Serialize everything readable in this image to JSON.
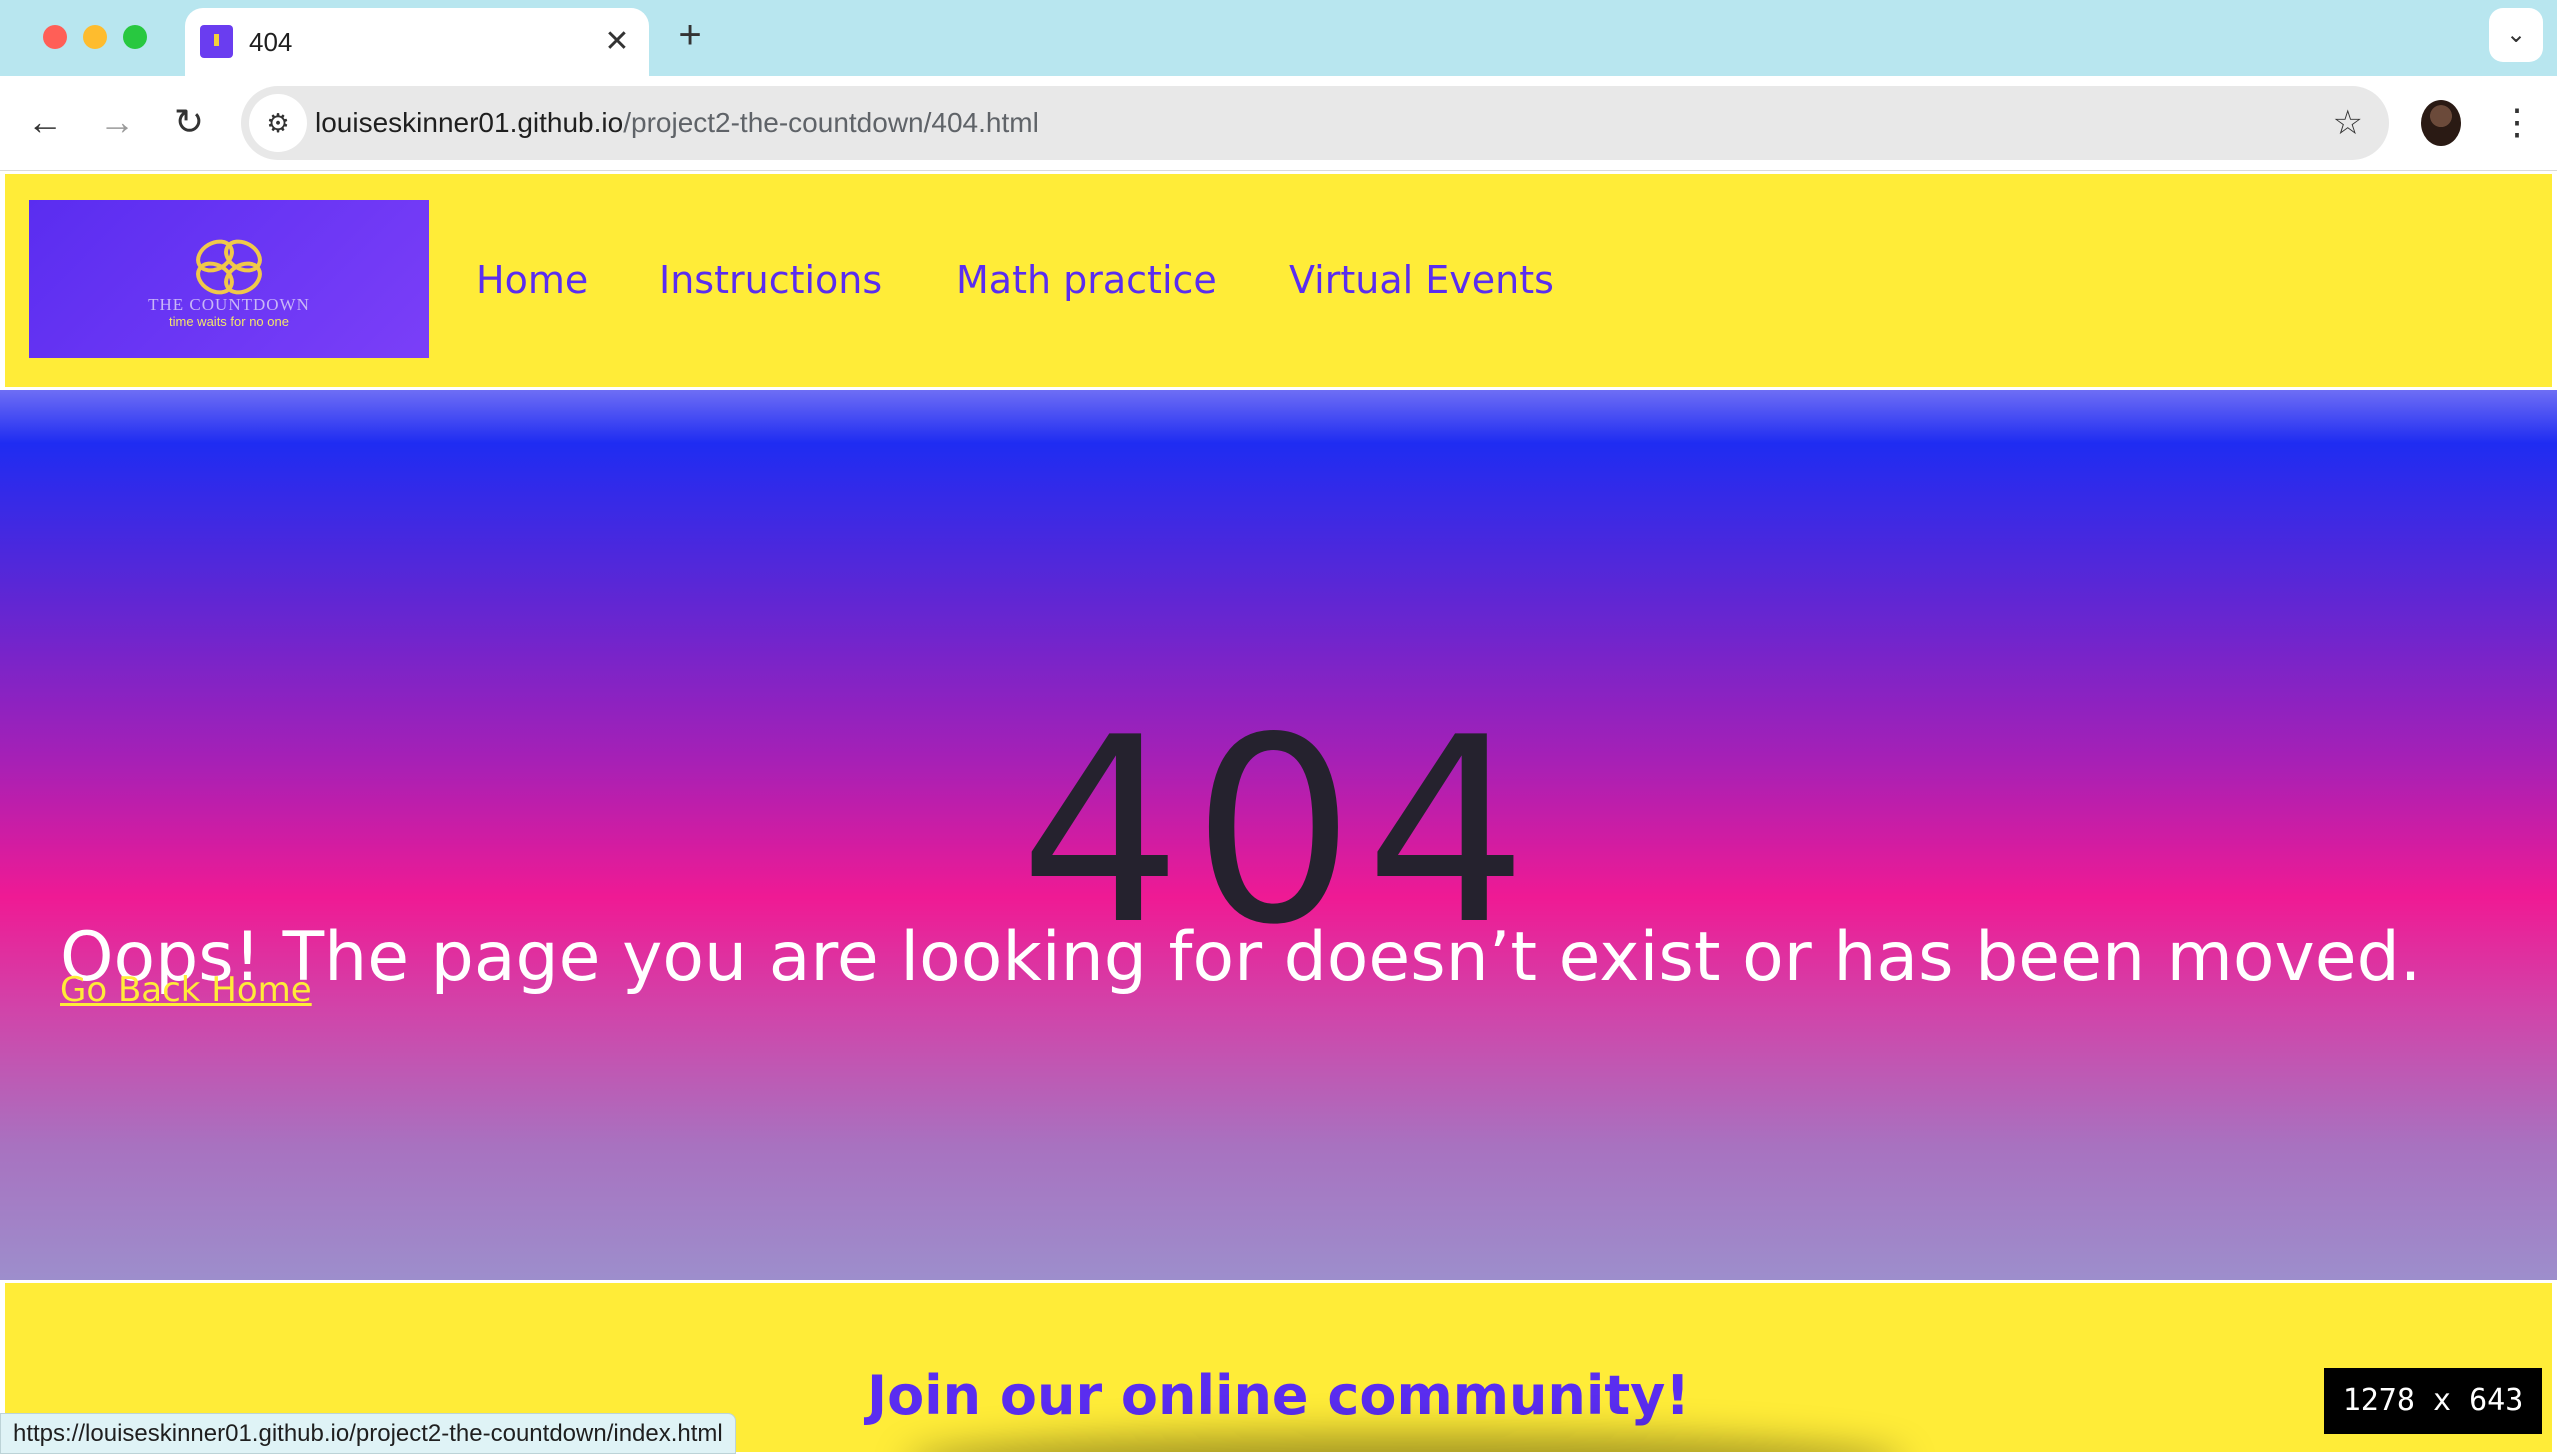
{
  "browser": {
    "tab": {
      "title": "404",
      "close_glyph": "✕"
    },
    "new_tab_glyph": "+",
    "tab_search_glyph": "⌄",
    "nav": {
      "back_glyph": "←",
      "forward_glyph": "→",
      "reload_glyph": "↻"
    },
    "url": {
      "domain": "louiseskinner01.github.io",
      "path": "/project2-the-countdown/404.html"
    },
    "site_info_glyph": "⚙",
    "bookmark_glyph": "☆",
    "menu_glyph": "⋮",
    "status_url": "https://louiseskinner01.github.io/project2-the-countdown/index.html",
    "viewport_size": "1278 x 643"
  },
  "site": {
    "logo": {
      "name": "THE COUNTDOWN",
      "tagline": "time waits for no one"
    },
    "nav": [
      {
        "label": "Home"
      },
      {
        "label": "Instructions"
      },
      {
        "label": "Math practice"
      },
      {
        "label": "Virtual Events"
      }
    ],
    "error": {
      "code": "404",
      "message": "Oops! The page you are looking for doesn’t exist or has been moved.",
      "link_label": "Go Back Home"
    },
    "footer": {
      "title": "Join our online community!"
    },
    "colors": {
      "header_bg": "#ffec38",
      "brand_purple": "#5a2df0",
      "link_yellow": "#ffec38"
    }
  }
}
